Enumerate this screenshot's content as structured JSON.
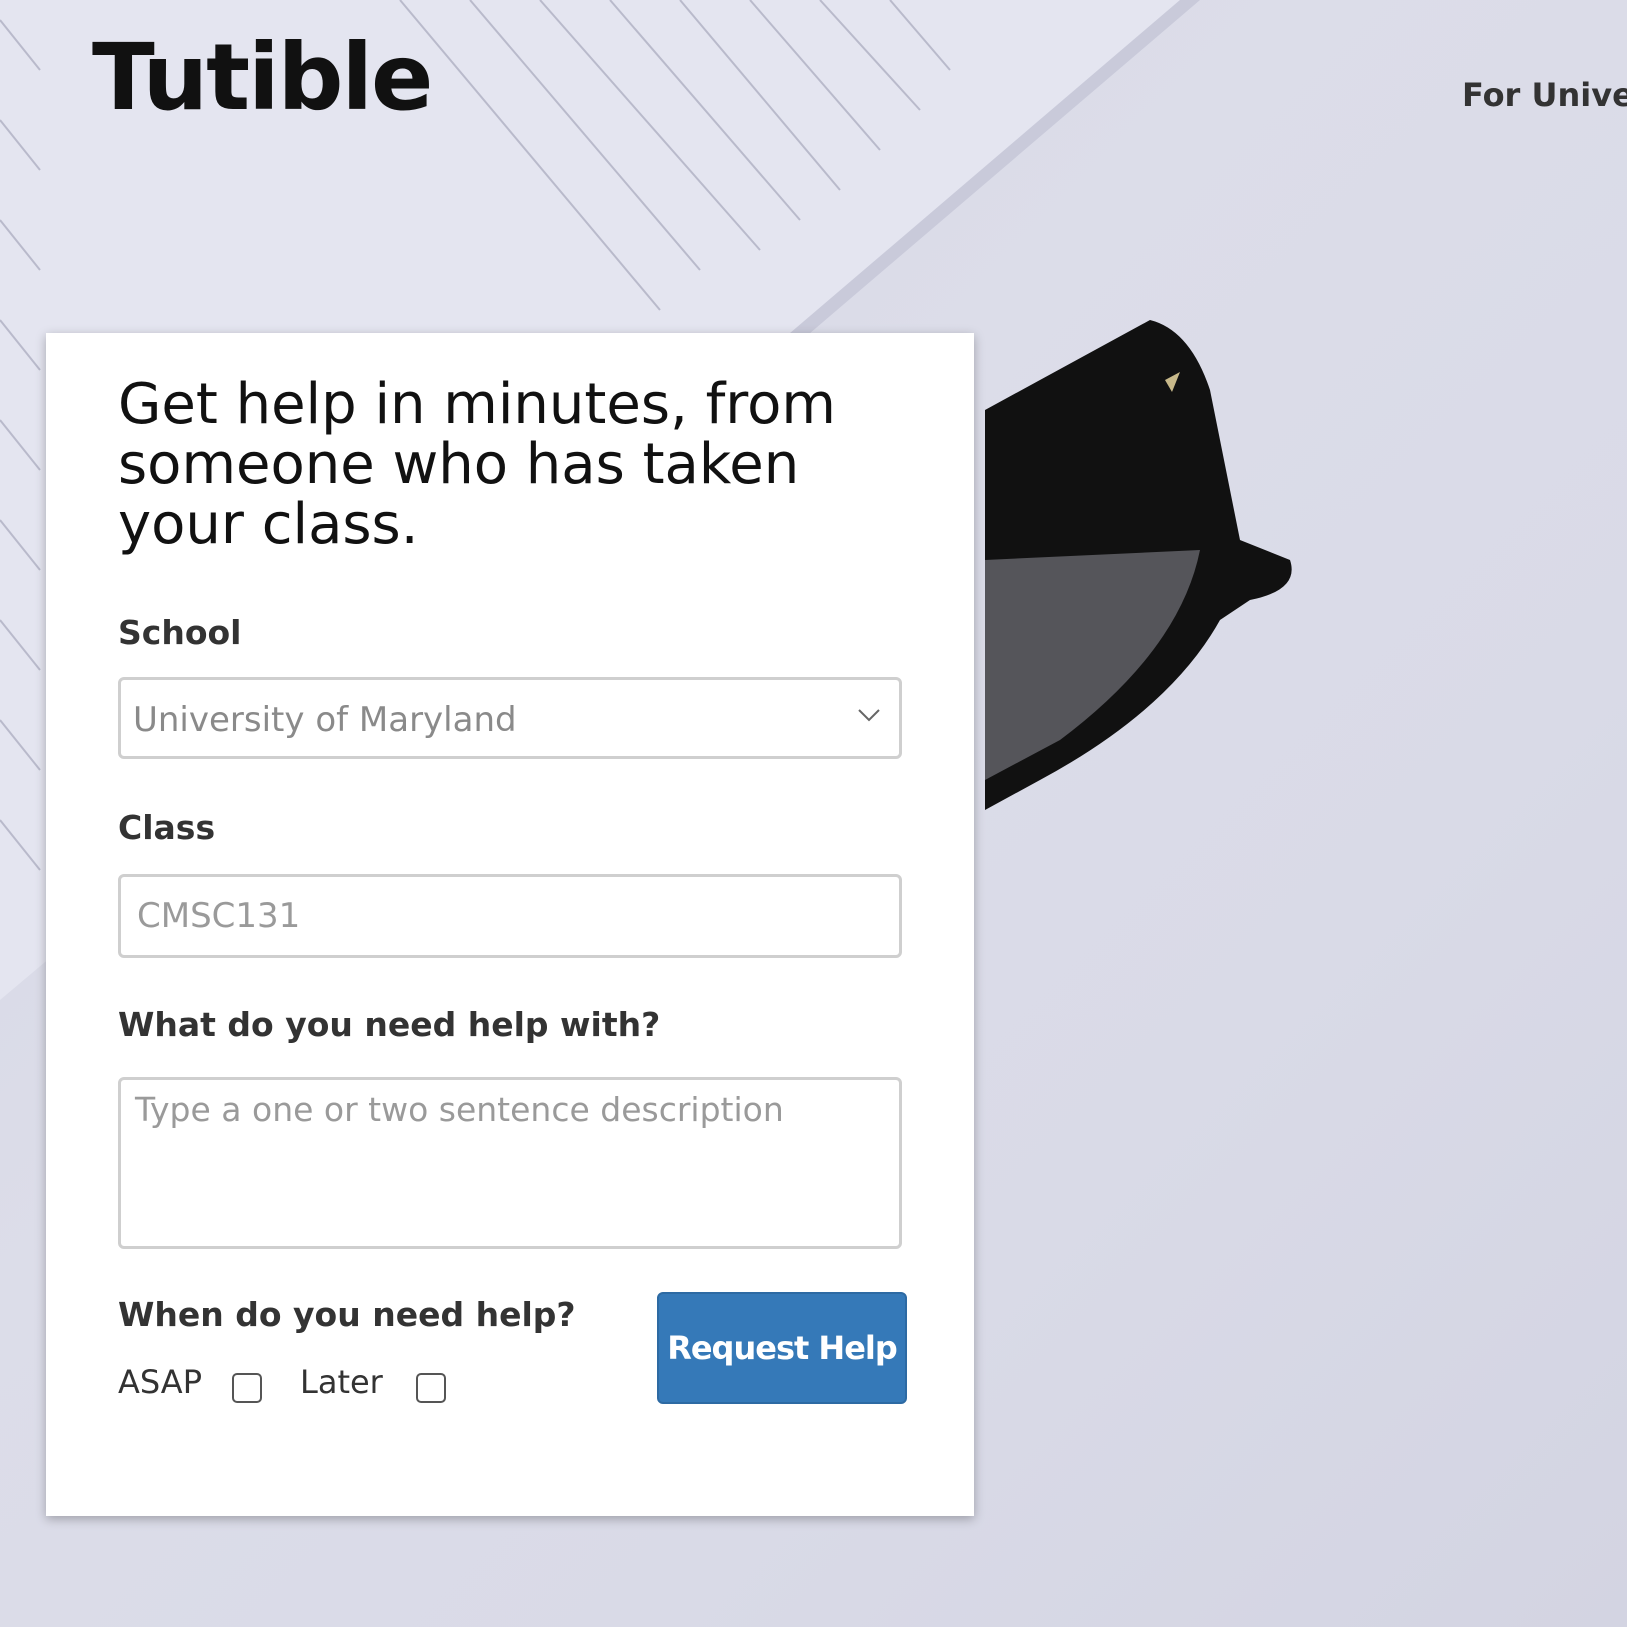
{
  "header": {
    "logo": "Tutible",
    "nav_link": "For Univer"
  },
  "form": {
    "headline": "Get help in minutes, from someone who has taken your class.",
    "school_label": "School",
    "school_value": "University of Maryland",
    "class_label": "Class",
    "class_placeholder": "CMSC131",
    "help_label": "What do you need help with?",
    "help_placeholder": "Type a one or two sentence description",
    "when_label": "When do you need help?",
    "option_asap": "ASAP",
    "option_later": "Later",
    "submit_label": "Request Help"
  },
  "colors": {
    "accent": "#3579b8",
    "background": "#d9dae7"
  },
  "icons": {
    "select_chevron": "chevron-down-icon"
  }
}
